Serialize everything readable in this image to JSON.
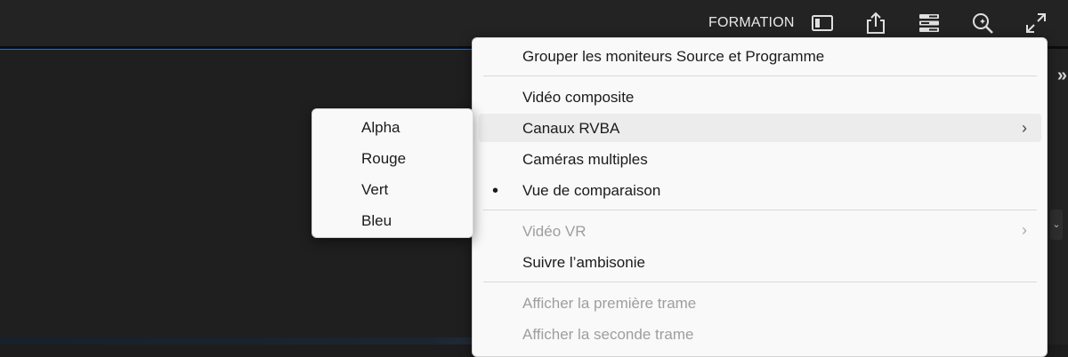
{
  "header": {
    "workspace_label": "FORMATION",
    "icons": [
      "panel-layout-icon",
      "export-icon",
      "workspaces-menu-icon",
      "search-sparkle-icon",
      "fullscreen-icon"
    ]
  },
  "side": {
    "expand_glyph": "»",
    "box_glyph": "⌄"
  },
  "menu": {
    "items": [
      {
        "label": "Grouper les moniteurs Source et Programme",
        "enabled": true
      },
      {
        "label": "Vidéo composite",
        "enabled": true
      },
      {
        "label": "Canaux RVBA",
        "enabled": true,
        "submenu": true,
        "highlighted": true
      },
      {
        "label": "Caméras multiples",
        "enabled": true
      },
      {
        "label": "Vue de comparaison",
        "enabled": true,
        "checked": true
      },
      {
        "label": "Vidéo VR",
        "enabled": false,
        "submenu": true
      },
      {
        "label": "Suivre l’ambisonie",
        "enabled": true
      },
      {
        "label": "Afficher la première trame",
        "enabled": false
      },
      {
        "label": "Afficher la seconde trame",
        "enabled": false
      }
    ],
    "submenu_glyph": "›",
    "bullet_glyph": "•"
  },
  "submenu": {
    "items": [
      {
        "label": "Alpha"
      },
      {
        "label": "Rouge"
      },
      {
        "label": "Vert"
      },
      {
        "label": "Bleu"
      }
    ]
  },
  "colors": {
    "app_background": "#1d1d1d",
    "menu_background": "#f9f9f9",
    "menu_highlight": "#ececec",
    "disabled_text": "#9e9e9e",
    "accent_line": "#2f6fb8"
  }
}
